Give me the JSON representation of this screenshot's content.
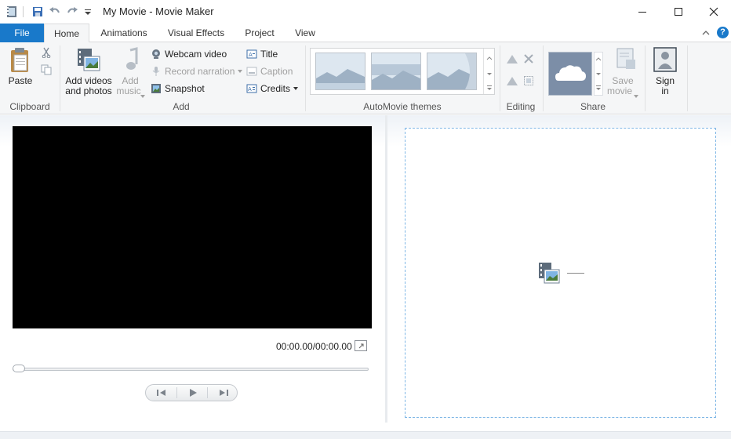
{
  "window": {
    "title": "My Movie - Movie Maker",
    "minimize_icon": "minimize-icon",
    "maximize_icon": "maximize-icon",
    "close_icon": "close-icon"
  },
  "quick_access": [
    "app-icon",
    "save-icon",
    "undo-icon",
    "redo-icon",
    "customize-qat-icon"
  ],
  "tabs": [
    {
      "label": "File"
    },
    {
      "label": "Home"
    },
    {
      "label": "Animations"
    },
    {
      "label": "Visual Effects"
    },
    {
      "label": "Project"
    },
    {
      "label": "View"
    }
  ],
  "ribbon": {
    "clipboard": {
      "label": "Clipboard",
      "paste": "Paste"
    },
    "add": {
      "label": "Add",
      "add_videos_line1": "Add videos",
      "add_videos_line2": "and photos",
      "add_music_line1": "Add",
      "add_music_line2": "music",
      "webcam": "Webcam video",
      "narration": "Record narration",
      "snapshot": "Snapshot",
      "title": "Title",
      "caption": "Caption",
      "credits": "Credits"
    },
    "themes": {
      "label": "AutoMovie themes"
    },
    "editing": {
      "label": "Editing"
    },
    "share": {
      "label": "Share",
      "save_line1": "Save",
      "save_line2": "movie",
      "signin_line1": "Sign",
      "signin_line2": "in"
    }
  },
  "player": {
    "time": "00:00.00/00:00.00"
  },
  "colors": {
    "file_tab": "#1979ca",
    "help": "#1979ca",
    "storyboard_border": "#7fb7e6"
  }
}
